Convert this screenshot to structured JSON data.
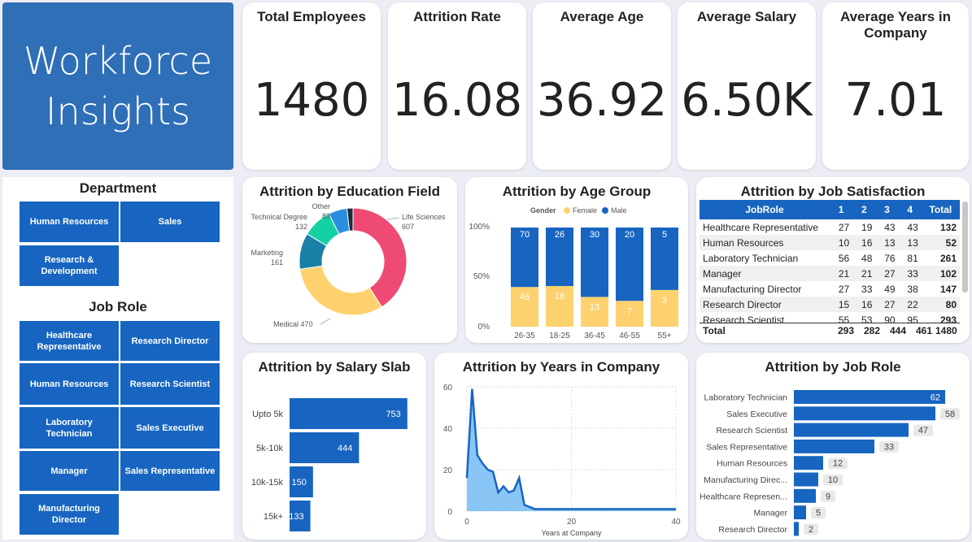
{
  "report_title": "Workforce\nInsights",
  "kpis": [
    {
      "label": "Total Employees",
      "value": "1480"
    },
    {
      "label": "Attrition Rate",
      "value": "16.08"
    },
    {
      "label": "Average Age",
      "value": "36.92"
    },
    {
      "label": "Average Salary",
      "value": "6.50K"
    },
    {
      "label": "Average Years in Company",
      "value": "7.01"
    }
  ],
  "slicers": {
    "department": {
      "title": "Department",
      "items": [
        "Human Resources",
        "Sales",
        "Research & Development"
      ]
    },
    "job_role": {
      "title": "Job Role",
      "items": [
        "Healthcare Representative",
        "Research Director",
        "Human Resources",
        "Research Scientist",
        "Laboratory Technician",
        "Sales Executive",
        "Manager",
        "Sales Representative",
        "Manufacturing Director"
      ]
    }
  },
  "education_chart": {
    "title": "Attrition by Education Field",
    "colors": [
      "#ef4a73",
      "#fdd26e",
      "#1b80a6",
      "#14d1a3",
      "#2a8ee0",
      "#1e2a3a"
    ],
    "slice_labels": [
      "Life Sciences",
      "Medical",
      "Marketing",
      "Technical Degree",
      "Other",
      ""
    ]
  },
  "age_chart": {
    "title": "Attrition by Age Group",
    "legend_title": "Gender",
    "legend": [
      "Female",
      "Male"
    ],
    "y_ticks": [
      "100%",
      "50%",
      "0%"
    ],
    "colors": {
      "Female": "#fdd26e",
      "Male": "#1765c0"
    }
  },
  "job_satisfaction_table": {
    "title": "Attrition by Job Satisfaction",
    "columns": [
      "JobRole",
      "1",
      "2",
      "3",
      "4",
      "Total"
    ],
    "rows": [
      [
        "Healthcare Representative",
        "27",
        "19",
        "43",
        "43",
        "132"
      ],
      [
        "Human Resources",
        "10",
        "16",
        "13",
        "13",
        "52"
      ],
      [
        "Laboratory Technician",
        "56",
        "48",
        "76",
        "81",
        "261"
      ],
      [
        "Manager",
        "21",
        "21",
        "27",
        "33",
        "102"
      ],
      [
        "Manufacturing Director",
        "27",
        "33",
        "49",
        "38",
        "147"
      ],
      [
        "Research Director",
        "15",
        "16",
        "27",
        "22",
        "80"
      ],
      [
        "Research Scientist",
        "55",
        "53",
        "90",
        "95",
        "293"
      ]
    ],
    "total": [
      "Total",
      "293",
      "282",
      "444",
      "461",
      "1480"
    ]
  },
  "salary_chart": {
    "title": "Attrition by Salary Slab",
    "color": "#1765c0"
  },
  "years_chart": {
    "title": "Attrition by Years in Company",
    "x_label": "Years at Company",
    "x_ticks": [
      "0",
      "20",
      "40"
    ],
    "y_ticks": [
      "60",
      "40",
      "20",
      "0"
    ],
    "color": "#1765c0"
  },
  "jobrole_chart": {
    "title": "Attrition by Job Role",
    "color": "#1765c0"
  },
  "chart_data": [
    {
      "type": "pie",
      "title": "Attrition by Education Field",
      "categories": [
        "Life Sciences",
        "Medical",
        "Marketing",
        "Technical Degree",
        "Other",
        ""
      ],
      "values": [
        607,
        470,
        161,
        132,
        83,
        27
      ]
    },
    {
      "type": "bar",
      "title": "Attrition by Age Group",
      "categories": [
        "26-35",
        "18-25",
        "36-45",
        "46-55",
        "55+"
      ],
      "series": [
        {
          "name": "Male",
          "values": [
            70,
            26,
            30,
            20,
            5
          ],
          "share": [
            0.6,
            0.59,
            0.7,
            0.74,
            0.63
          ]
        },
        {
          "name": "Female",
          "values": [
            46,
            18,
            13,
            7,
            3
          ],
          "share": [
            0.4,
            0.41,
            0.3,
            0.26,
            0.37
          ]
        }
      ],
      "ylim": [
        0,
        1
      ]
    },
    {
      "type": "bar",
      "title": "Attrition by Salary Slab",
      "categories": [
        "Upto 5k",
        "5k-10k",
        "10k-15k",
        "15k+"
      ],
      "values": [
        753,
        444,
        150,
        133
      ]
    },
    {
      "type": "area",
      "title": "Attrition by Years in Company",
      "xlabel": "Years at Company",
      "x": [
        0,
        1,
        2,
        3,
        4,
        5,
        6,
        7,
        8,
        9,
        10,
        11,
        12,
        13,
        14,
        15,
        16,
        17,
        18,
        19,
        20,
        22,
        25,
        30,
        35,
        40
      ],
      "values": [
        16,
        59,
        27,
        23,
        20,
        19,
        9,
        12,
        9,
        10,
        16,
        3,
        2,
        1,
        1,
        1,
        1,
        1,
        1,
        1,
        1,
        1,
        1,
        1,
        1,
        1
      ],
      "xlim": [
        0,
        40
      ],
      "ylim": [
        0,
        60
      ]
    },
    {
      "type": "bar",
      "title": "Attrition by Job Role",
      "categories": [
        "Laboratory Technician",
        "Sales Executive",
        "Research Scientist",
        "Sales Representative",
        "Human Resources",
        "Manufacturing Direc...",
        "Healthcare Represen...",
        "Manager",
        "Research Director"
      ],
      "values": [
        62,
        58,
        47,
        33,
        12,
        10,
        9,
        5,
        2
      ]
    }
  ]
}
